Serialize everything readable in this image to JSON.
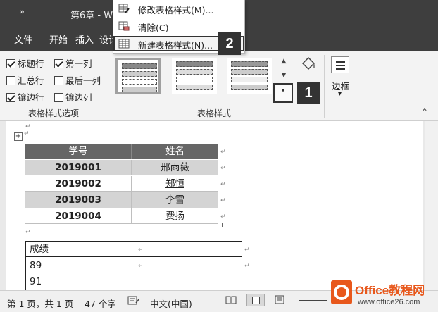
{
  "titlebar": {
    "qat_glyph": "»",
    "doc_title": "第6章 - W"
  },
  "ribbon_tabs": [
    "文件",
    "开始",
    "插入",
    "设计"
  ],
  "context_menu": {
    "items": [
      {
        "label": "修改表格样式(M)...",
        "icon": "modify-style-icon"
      },
      {
        "label": "清除(C)",
        "icon": "clear-icon"
      },
      {
        "label": "新建表格样式(N)...",
        "icon": "new-table-style-icon"
      }
    ]
  },
  "callouts": {
    "menu_step": "2",
    "more_step": "1"
  },
  "style_options": {
    "items": [
      {
        "label": "标题行",
        "checked": true
      },
      {
        "label": "第一列",
        "checked": true
      },
      {
        "label": "汇总行",
        "checked": false
      },
      {
        "label": "最后一列",
        "checked": false
      },
      {
        "label": "镶边行",
        "checked": true
      },
      {
        "label": "镶边列",
        "checked": false
      }
    ],
    "group_label": "表格样式选项"
  },
  "table_styles": {
    "group_label": "表格样式"
  },
  "borders": {
    "label": "边框",
    "dropdown": "▾"
  },
  "document": {
    "para_mark": "↵",
    "move_handle": "+",
    "table1": {
      "header": [
        "学号",
        "姓名"
      ],
      "rows": [
        [
          "2019001",
          "邢雨薇"
        ],
        [
          "2019002",
          "郑恒"
        ],
        [
          "2019003",
          "李雪"
        ],
        [
          "2019004",
          "费扬"
        ]
      ]
    },
    "table2": {
      "rows": [
        [
          "成绩",
          ""
        ],
        [
          "89",
          ""
        ],
        [
          "91",
          ""
        ]
      ]
    }
  },
  "statusbar": {
    "page": "第 1 页，共 1 页",
    "words": "47 个字",
    "language": "中文(中国)"
  },
  "watermark": {
    "site": "Office教程网",
    "url": "www.office26.com"
  },
  "colors": {
    "titlebar": "#3e3e3e",
    "table_header": "#666666",
    "band_row": "#d4d4d4",
    "office_orange": "#e8581c"
  }
}
